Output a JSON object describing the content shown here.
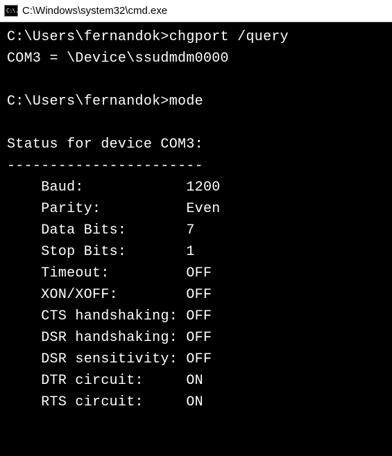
{
  "window": {
    "icon_text": "C:\\.",
    "title": "C:\\Windows\\system32\\cmd.exe"
  },
  "terminal": {
    "prompt1": "C:\\Users\\fernandok>",
    "command1": "chgport /query",
    "output1": "COM3 = \\Device\\ssudmdm0000",
    "prompt2": "C:\\Users\\fernandok>",
    "command2": "mode",
    "status_header": "Status for device COM3:",
    "divider": "-----------------------",
    "rows": [
      {
        "label": "Baud:           ",
        "value": "1200"
      },
      {
        "label": "Parity:         ",
        "value": "Even"
      },
      {
        "label": "Data Bits:      ",
        "value": "7"
      },
      {
        "label": "Stop Bits:      ",
        "value": "1"
      },
      {
        "label": "Timeout:        ",
        "value": "OFF"
      },
      {
        "label": "XON/XOFF:       ",
        "value": "OFF"
      },
      {
        "label": "CTS handshaking:",
        "value": "OFF"
      },
      {
        "label": "DSR handshaking:",
        "value": "OFF"
      },
      {
        "label": "DSR sensitivity:",
        "value": "OFF"
      },
      {
        "label": "DTR circuit:    ",
        "value": "ON"
      },
      {
        "label": "RTS circuit:    ",
        "value": "ON"
      }
    ],
    "indent": "    "
  }
}
